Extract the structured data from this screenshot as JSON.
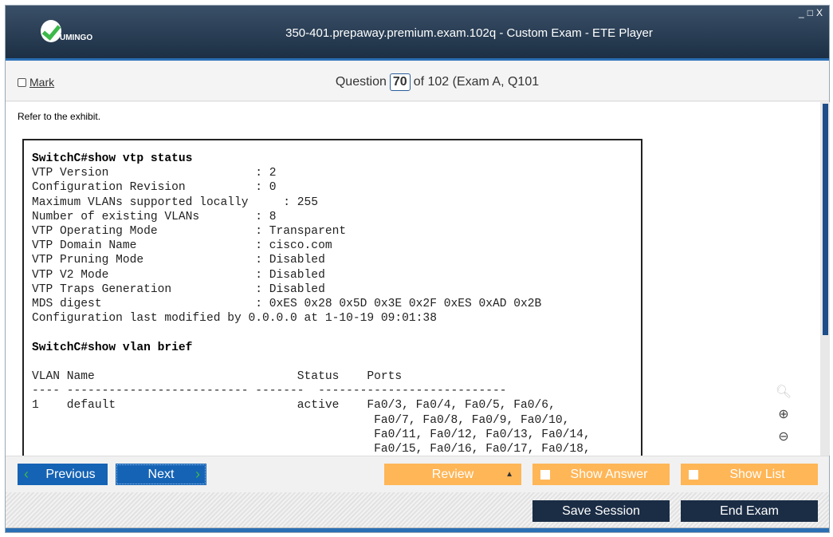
{
  "window": {
    "title": "350-401.prepaway.premium.exam.102q - Custom Exam - ETE Player",
    "logo_text": "UMINGO",
    "controls": [
      "_",
      "□",
      "X"
    ]
  },
  "question_bar": {
    "mark_label": "Mark",
    "question_label": "Question",
    "question_number": "70",
    "of_text": "of 102 (Exam A, Q101"
  },
  "content": {
    "intro": "Refer to the exhibit.",
    "exhibit_lines": [
      {
        "text": "SwitchC#show vtp status",
        "bold": true
      },
      {
        "text": "VTP Version                     : 2"
      },
      {
        "text": "Configuration Revision          : 0"
      },
      {
        "text": "Maximum VLANs supported locally     : 255"
      },
      {
        "text": "Number of existing VLANs        : 8"
      },
      {
        "text": "VTP Operating Mode              : Transparent"
      },
      {
        "text": "VTP Domain Name                 : cisco.com"
      },
      {
        "text": "VTP Pruning Mode                : Disabled"
      },
      {
        "text": "VTP V2 Mode                     : Disabled"
      },
      {
        "text": "VTP Traps Generation            : Disabled"
      },
      {
        "text": "MDS digest                      : 0xES 0x28 0x5D 0x3E 0x2F 0xES 0xAD 0x2B"
      },
      {
        "text": "Configuration last modified by 0.0.0.0 at 1-10-19 09:01:38"
      },
      {
        "text": ""
      },
      {
        "text": "SwitchC#show vlan brief",
        "bold": true
      },
      {
        "text": ""
      },
      {
        "text": "VLAN Name                             Status    Ports"
      },
      {
        "text": "---- -------------------------- -------  ---------------------------"
      },
      {
        "text": "1    default                          active    Fa0/3, Fa0/4, Fa0/5, Fa0/6,"
      },
      {
        "text": "                                                 Fa0/7, Fa0/8, Fa0/9, Fa0/10,"
      },
      {
        "text": "                                                 Fa0/11, Fa0/12, Fa0/13, Fa0/14,"
      },
      {
        "text": "                                                 Fa0/15, Fa0/16, Fa0/17, Fa0/18,"
      }
    ]
  },
  "toolbar": {
    "previous": "Previous",
    "next": "Next",
    "review": "Review",
    "show_answer": "Show Answer",
    "show_list": "Show List"
  },
  "footer": {
    "save_session": "Save Session",
    "end_exam": "End Exam"
  },
  "colors": {
    "header": "#1c2f44",
    "accent_blue": "#1563b5",
    "orange": "#ffb657",
    "dark_button": "#1b2d45"
  }
}
